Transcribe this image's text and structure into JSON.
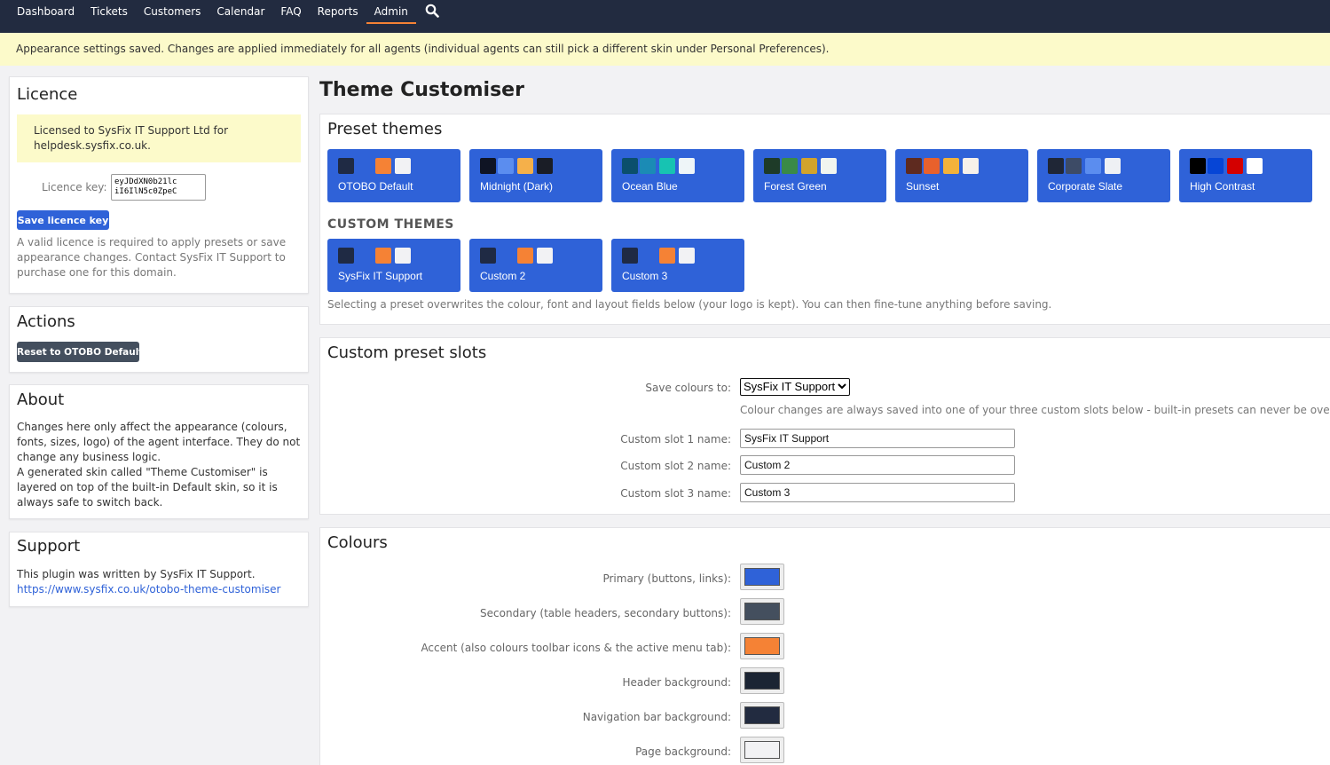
{
  "nav": {
    "items": [
      "Dashboard",
      "Tickets",
      "Customers",
      "Calendar",
      "FAQ",
      "Reports",
      "Admin"
    ],
    "active": "Admin",
    "search_icon": "search-icon"
  },
  "banner": {
    "text": "Appearance settings saved. Changes are applied immediately for all agents (individual agents can still pick a different skin under Personal Preferences)."
  },
  "licence": {
    "title": "Licence",
    "licensed_to": "Licensed to SysFix IT Support Ltd for helpdesk.sysfix.co.uk.",
    "key_label": "Licence key:",
    "key_value": "eyJDdXN0b21lc iI6IlN5c0ZpeC",
    "save_button": "Save licence key",
    "note": "A valid licence is required to apply presets or save appearance changes. Contact SysFix IT Support to purchase one for this domain."
  },
  "actions": {
    "title": "Actions",
    "reset_button": "Reset to OTOBO Default"
  },
  "about": {
    "title": "About",
    "text1": "Changes here only affect the appearance (colours, fonts, sizes, logo) of the agent interface. They do not change any business logic.",
    "text2": "A generated skin called \"Theme Customiser\" is layered on top of the built-in Default skin, so it is always safe to switch back."
  },
  "support": {
    "title": "Support",
    "text": "This plugin was written by SysFix IT Support.",
    "link": "https://www.sysfix.co.uk/otobo-theme-customiser"
  },
  "page_title": "Theme Customiser",
  "presets": {
    "title": "Preset themes",
    "themes": [
      {
        "name": "OTOBO Default",
        "swatches": [
          "#1f2a44",
          "#2f62d8",
          "#f58235",
          "#f2f2f4"
        ]
      },
      {
        "name": "Midnight (Dark)",
        "swatches": [
          "#0f1424",
          "#5b8def",
          "#f5b04a",
          "#1a1d26"
        ]
      },
      {
        "name": "Ocean Blue",
        "swatches": [
          "#0b4f6c",
          "#1b8bb5",
          "#17c3b2",
          "#eef5f8"
        ]
      },
      {
        "name": "Forest Green",
        "swatches": [
          "#1e3b28",
          "#3a8a47",
          "#d2a32b",
          "#f1f5ef"
        ]
      },
      {
        "name": "Sunset",
        "swatches": [
          "#5e2a1f",
          "#e8612c",
          "#f3b23a",
          "#f7f1ea"
        ]
      },
      {
        "name": "Corporate Slate",
        "swatches": [
          "#1f2636",
          "#3d4b66",
          "#5b8def",
          "#eef0f4"
        ]
      },
      {
        "name": "High Contrast",
        "swatches": [
          "#000000",
          "#0645d6",
          "#d40000",
          "#ffffff"
        ]
      }
    ],
    "custom_heading": "CUSTOM THEMES",
    "custom": [
      {
        "name": "SysFix IT Support",
        "swatches": [
          "#1f2a44",
          "#2f62d8",
          "#f58235",
          "#f2f2f4"
        ]
      },
      {
        "name": "Custom 2",
        "swatches": [
          "#1f2a44",
          "#2f62d8",
          "#f58235",
          "#f2f2f4"
        ]
      },
      {
        "name": "Custom 3",
        "swatches": [
          "#1f2a44",
          "#2f62d8",
          "#f58235",
          "#f2f2f4"
        ]
      }
    ],
    "note": "Selecting a preset overwrites the colour, font and layout fields below (your logo is kept). You can then fine-tune anything before saving."
  },
  "slots": {
    "title": "Custom preset slots",
    "save_to_label": "Save colours to:",
    "save_to_value": "SysFix IT Support",
    "save_to_note": "Colour changes are always saved into one of your three custom slots below - built-in presets can never be overwritten.",
    "slot1_label": "Custom slot 1 name:",
    "slot1_value": "SysFix IT Support",
    "slot2_label": "Custom slot 2 name:",
    "slot2_value": "Custom 2",
    "slot3_label": "Custom slot 3 name:",
    "slot3_value": "Custom 3"
  },
  "colours": {
    "title": "Colours",
    "fields": [
      {
        "label": "Primary (buttons, links):",
        "color": "#2f62d8"
      },
      {
        "label": "Secondary (table headers, secondary buttons):",
        "color": "#444f5e"
      },
      {
        "label": "Accent (also colours toolbar icons & the active menu tab):",
        "color": "#f58235"
      },
      {
        "label": "Header background:",
        "color": "#1b2433"
      },
      {
        "label": "Navigation bar background:",
        "color": "#222b40"
      },
      {
        "label": "Page background:",
        "color": "#f2f2f4"
      }
    ]
  }
}
